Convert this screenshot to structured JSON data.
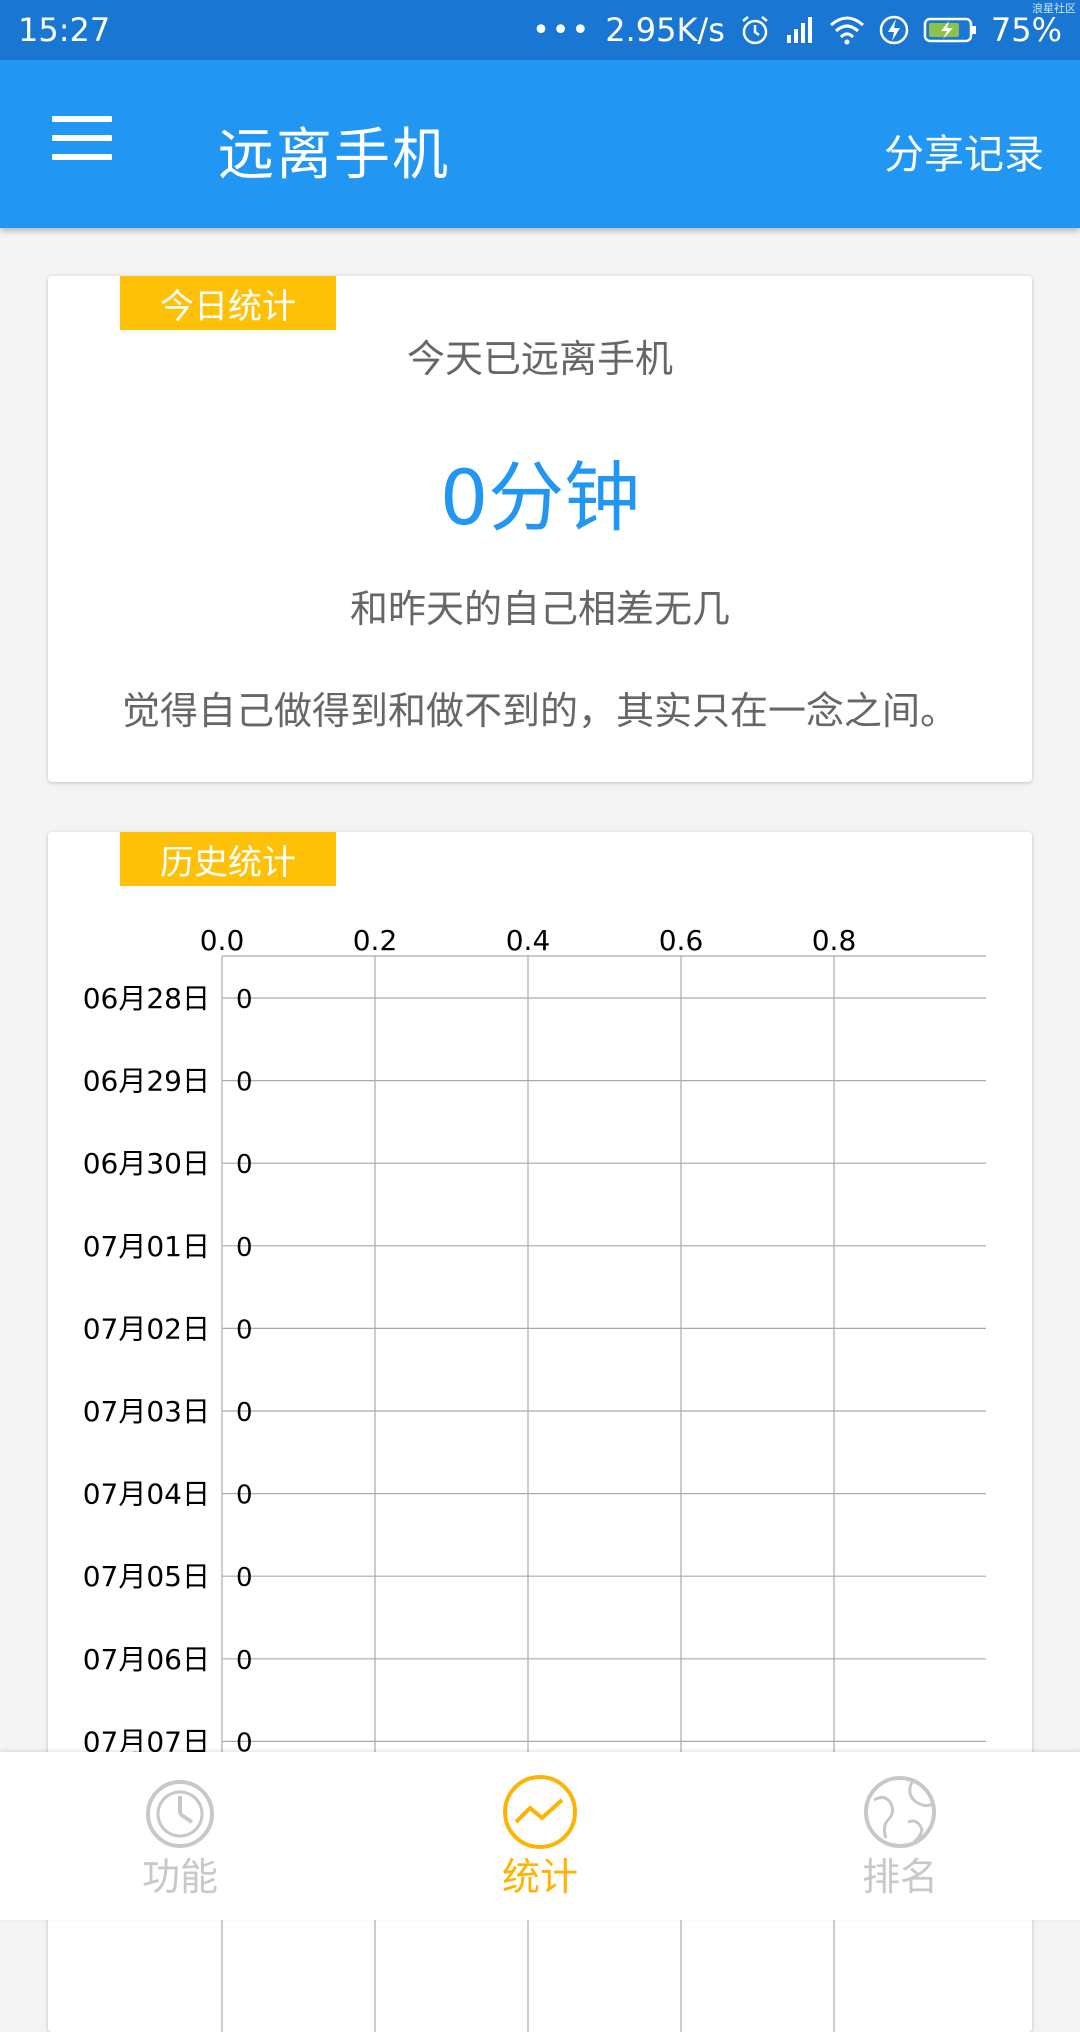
{
  "status_bar": {
    "time": "15:27",
    "dots": "•••",
    "network_speed": "2.95K/s",
    "battery": "75%",
    "watermark": "浪星社区"
  },
  "app_bar": {
    "title": "远离手机",
    "share_label": "分享记录"
  },
  "today_card": {
    "tag": "今日统计",
    "subtitle": "今天已远离手机",
    "duration": "0分钟",
    "comparison": "和昨天的自己相差无几",
    "quote": "觉得自己做得到和做不到的，其实只在一念之间。"
  },
  "history_card": {
    "tag": "历史统计"
  },
  "chart_data": {
    "type": "bar",
    "orientation": "horizontal",
    "categories": [
      "06月28日",
      "06月29日",
      "06月30日",
      "07月01日",
      "07月02日",
      "07月03日",
      "07月04日",
      "07月05日",
      "07月06日",
      "07月07日"
    ],
    "values": [
      0,
      0,
      0,
      0,
      0,
      0,
      0,
      0,
      0,
      0
    ],
    "value_labels": [
      "0",
      "0",
      "0",
      "0",
      "0",
      "0",
      "0",
      "0",
      "0",
      "0"
    ],
    "x_ticks": [
      "0.0",
      "0.2",
      "0.4",
      "0.6",
      "0.8"
    ],
    "xlim": [
      0,
      1
    ],
    "x_axis_position": "top",
    "grid": true
  },
  "bottom_nav": {
    "items": [
      {
        "label": "功能",
        "icon": "timer-icon",
        "active": false
      },
      {
        "label": "统计",
        "icon": "trend-chart-icon",
        "active": true
      },
      {
        "label": "排名",
        "icon": "globe-icon",
        "active": false
      }
    ]
  },
  "colors": {
    "primary": "#2196f3",
    "status_bar": "#1976d2",
    "accent": "#ffc107",
    "nav_active": "#ffb300",
    "nav_inactive": "#c8c8c8"
  }
}
